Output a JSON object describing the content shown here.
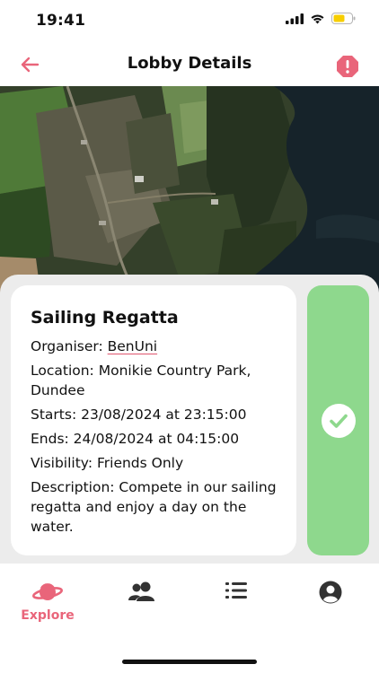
{
  "status_bar": {
    "time": "19:41"
  },
  "nav": {
    "title": "Lobby Details"
  },
  "lobby": {
    "title": "Sailing Regatta",
    "organiser_label": "Organiser: ",
    "organiser_name": "BenUni",
    "location": "Location: Monikie Country Park, Dundee",
    "starts": "Starts: 23/08/2024 at 23:15:00",
    "ends": "Ends: 24/08/2024 at 04:15:00",
    "visibility": "Visibility: Friends Only",
    "description": "Description: Compete in our sailing regatta and enjoy a day on the water."
  },
  "tabs": [
    {
      "label": "Explore",
      "icon": "planet-icon",
      "active": true
    },
    {
      "label": "",
      "icon": "friends-icon",
      "active": false
    },
    {
      "label": "",
      "icon": "list-icon",
      "active": false
    },
    {
      "label": "",
      "icon": "profile-icon",
      "active": false
    }
  ],
  "colors": {
    "accent": "#e9657a",
    "join_green": "#8ed88d",
    "sheet_bg": "#ececec",
    "icon_dark": "#333333"
  }
}
